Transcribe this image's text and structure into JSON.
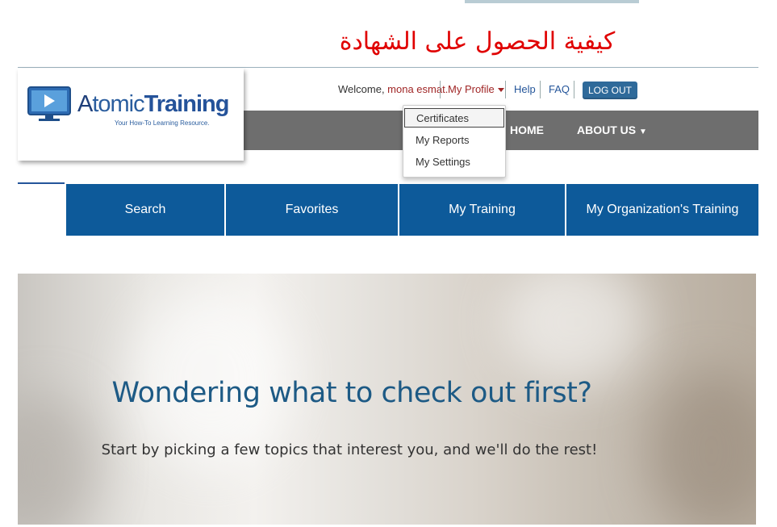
{
  "page_title_arabic": "كيفية الحصول على الشهادة",
  "logo": {
    "brand_prefix": "A",
    "brand_main": "tomic",
    "brand_bold": "Training",
    "tagline": "Your How-To Learning Resource."
  },
  "user_bar": {
    "welcome": "Welcome, ",
    "username": "mona esmat.",
    "my_profile": "My Profile",
    "help": "Help",
    "faq": "FAQ",
    "logout": "LOG OUT"
  },
  "profile_menu": {
    "items": [
      "Certificates",
      "My Reports",
      "My Settings"
    ],
    "active_index": 0
  },
  "main_nav": {
    "home": "HOME",
    "about": "ABOUT US"
  },
  "tabs": [
    "Search",
    "Favorites",
    "My Training",
    "My Organization's Training"
  ],
  "hero": {
    "title": "Wondering what to check out first?",
    "subtitle": "Start by picking a few topics that interest you, and we'll do the rest!"
  },
  "colors": {
    "nav_gray": "#6e6e6e",
    "tab_blue": "#0d5a9a",
    "accent_red": "#a02626",
    "link_blue": "#24559a",
    "arabic_red": "#e00000"
  }
}
